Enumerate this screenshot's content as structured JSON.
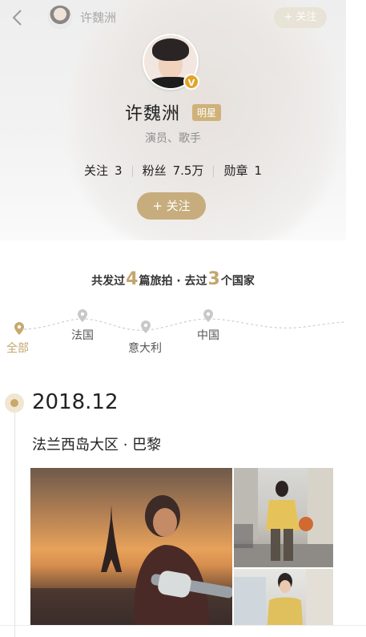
{
  "topbar": {
    "name": "许魏洲",
    "follow_label": "+ 关注",
    "back_icon": "chevron-left-icon"
  },
  "profile": {
    "name": "许魏洲",
    "badge": "明星",
    "verified_icon": "v-verified-icon",
    "role": "演员、歌手",
    "stats": [
      {
        "label": "关注",
        "value": "3"
      },
      {
        "label": "粉丝",
        "value": "7.5万"
      },
      {
        "label": "勋章",
        "value": "1"
      }
    ],
    "follow_button": "+ 关注"
  },
  "summary": {
    "prefix": "共发过",
    "posts": "4",
    "middle": "篇旅拍 · 去过",
    "countries": "3",
    "suffix": "个国家"
  },
  "route": {
    "stops": [
      {
        "label": "全部",
        "active": true
      },
      {
        "label": "法国",
        "active": false
      },
      {
        "label": "意大利",
        "active": false
      },
      {
        "label": "中国",
        "active": false
      }
    ]
  },
  "section": {
    "date": "2018.12",
    "location": "法兰西岛大区 · 巴黎"
  },
  "colors": {
    "accent": "#c7ad7d",
    "accent_text": "#c3a66f",
    "verified": "#e2a52b"
  }
}
